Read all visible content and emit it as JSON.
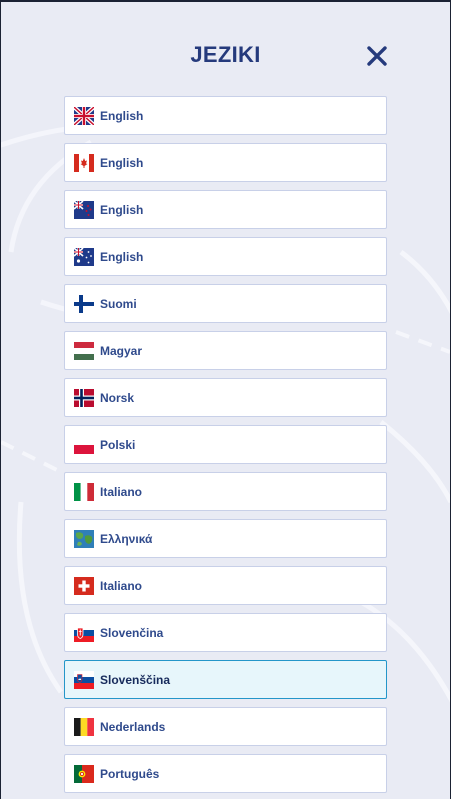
{
  "header": {
    "title": "JEZIKI"
  },
  "close_icon": "close-icon",
  "colors": {
    "title": "#253a7c",
    "selected_border": "#2496c9",
    "item_border": "#c8d0e8"
  },
  "languages": [
    {
      "label": "English",
      "flag": "uk-flag-icon"
    },
    {
      "label": "English",
      "flag": "canada-flag-icon"
    },
    {
      "label": "English",
      "flag": "new-zealand-flag-icon"
    },
    {
      "label": "English",
      "flag": "australia-flag-icon"
    },
    {
      "label": "Suomi",
      "flag": "finland-flag-icon"
    },
    {
      "label": "Magyar",
      "flag": "hungary-flag-icon"
    },
    {
      "label": "Norsk",
      "flag": "norway-flag-icon"
    },
    {
      "label": "Polski",
      "flag": "poland-flag-icon"
    },
    {
      "label": "Italiano",
      "flag": "italy-flag-icon"
    },
    {
      "label": "Ελληνικά",
      "flag": "greek-globe-flag-icon"
    },
    {
      "label": "Italiano",
      "flag": "switzerland-flag-icon"
    },
    {
      "label": "Slovenčina",
      "flag": "slovakia-flag-icon"
    },
    {
      "label": "Slovenščina",
      "flag": "slovenia-flag-icon",
      "selected": true
    },
    {
      "label": "Nederlands",
      "flag": "belgium-flag-icon"
    },
    {
      "label": "Português",
      "flag": "portugal-flag-icon"
    }
  ]
}
